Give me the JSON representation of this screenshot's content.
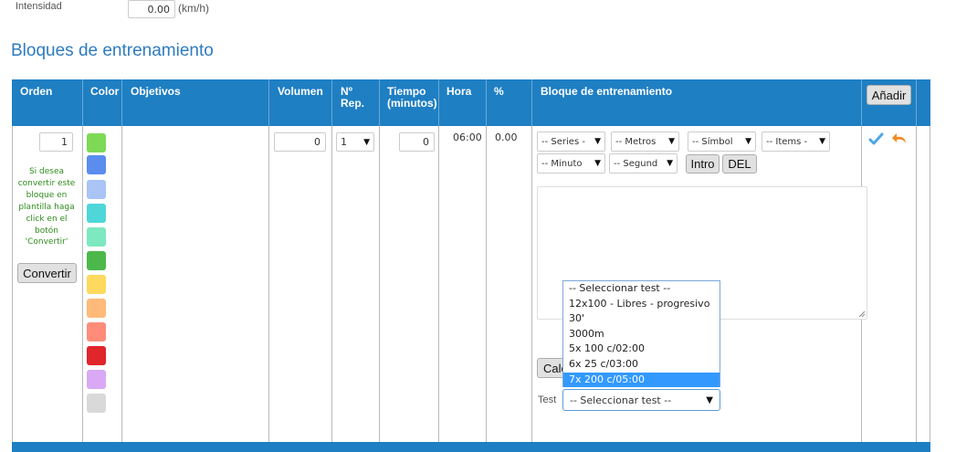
{
  "top": {
    "intensity_label": "Intensidad",
    "intensity_value": "0.00",
    "intensity_unit": "(km/h)"
  },
  "section_title": "Bloques de entrenamiento",
  "table": {
    "headers": {
      "orden": "Orden",
      "color": "Color",
      "objetivos": "Objetivos",
      "volumen": "Volumen",
      "rep_line1": "Nº",
      "rep_line2": "Rep.",
      "tiempo_line1": "Tiempo",
      "tiempo_line2": "(minutos)",
      "hora": "Hora",
      "pct": "%",
      "bloque": "Bloque de entrenamiento",
      "add_button": "Añadir"
    },
    "row": {
      "orden_value": "1",
      "convert_help_lines": [
        "Si desea",
        "convertir este",
        "bloque en",
        "plantilla haga",
        "click en el",
        "botón",
        "'Convertir'"
      ],
      "convert_button": "Convertir",
      "colors": [
        "#7ed957",
        "#5b8def",
        "#a9c4f5",
        "#4fd6d9",
        "#7ee8c0",
        "#4cb84c",
        "#ffd95e",
        "#ffba7a",
        "#ff8c7a",
        "#e0252b",
        "#d9a9f5",
        "#d9d9d9"
      ],
      "volumen_value": "0",
      "rep_value": "1",
      "tiempo_value": "0",
      "hora_value": "06:00",
      "pct_value": "0.00",
      "block_selects": {
        "series": "-- Series -",
        "metros": "-- Metros",
        "simbolo": "-- Símbol",
        "items": "-- Items -",
        "minutos": "-- Minuto",
        "segundos": "-- Segund"
      },
      "intro_button": "Intro",
      "del_button": "DEL",
      "calc_button_partial": "Calc",
      "test_label": "Test",
      "test_select_value": "-- Seleccionar test --"
    }
  },
  "test_dropdown_options": [
    "-- Seleccionar test --",
    "12x100 - Libres - progresivo",
    "30'",
    "3000m",
    "5x 100 c/02:00",
    "6x 25 c/03:00",
    "7x 200 c/05:00"
  ],
  "test_dropdown_selected_index": 6,
  "colors": {
    "header_blue": "#1f7fc3",
    "section_title_blue": "#2e7bbf",
    "help_text_green": "#2e8b1e",
    "selection_blue": "#3399ff"
  },
  "icons": {
    "confirm": "check-icon",
    "undo": "undo-icon"
  }
}
